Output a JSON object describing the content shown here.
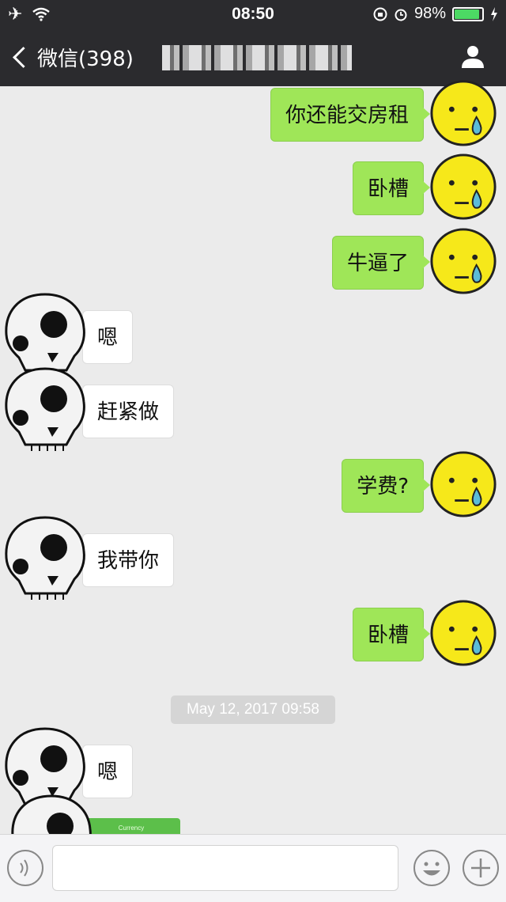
{
  "status_bar": {
    "time": "08:50",
    "battery_percent": "98%",
    "battery_level": 0.98,
    "left_icons": [
      "airplane-icon",
      "wifi-icon"
    ],
    "right_icons": [
      "rotation-lock-icon",
      "alarm-icon",
      "battery-icon",
      "charging-icon"
    ]
  },
  "nav": {
    "back_label": "微信(398)",
    "contact_name_obscured": true,
    "right_icon": "person-icon"
  },
  "messages": [
    {
      "side": "out",
      "text": "你还能交房租",
      "avatar": "crying-smiley-icon"
    },
    {
      "side": "out",
      "text": "卧槽",
      "avatar": "crying-smiley-icon"
    },
    {
      "side": "out",
      "text": "牛逼了",
      "avatar": "crying-smiley-icon"
    },
    {
      "side": "in",
      "text": "嗯",
      "avatar": "skull-icon"
    },
    {
      "side": "in",
      "text": "赶紧做",
      "avatar": "skull-icon"
    },
    {
      "side": "out",
      "text": "学费?",
      "avatar": "crying-smiley-icon"
    },
    {
      "side": "in",
      "text": "我带你",
      "avatar": "skull-icon"
    },
    {
      "side": "out",
      "text": "卧槽",
      "avatar": "crying-smiley-icon"
    },
    {
      "side": "in",
      "text": "嗯",
      "avatar": "skull-icon"
    }
  ],
  "timestamp": "May 12, 2017 09:58",
  "image_preview_label": "Currency",
  "input_bar": {
    "icons": [
      "voice-icon",
      "emoji-icon",
      "plus-icon"
    ]
  },
  "colors": {
    "nav_background": "#2b2b2e",
    "chat_background": "#ebebeb",
    "outgoing_bubble": "#9fe658",
    "incoming_bubble": "#ffffff"
  }
}
